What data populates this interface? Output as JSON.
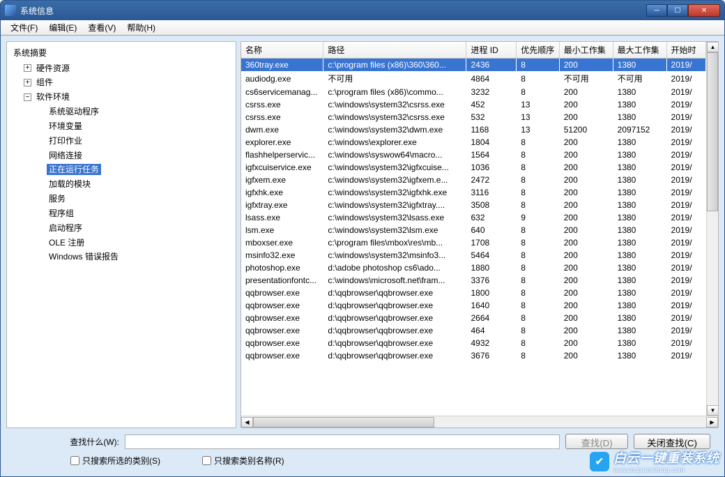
{
  "window": {
    "title": "系统信息"
  },
  "menubar": [
    "文件(F)",
    "编辑(E)",
    "查看(V)",
    "帮助(H)"
  ],
  "tree": {
    "root": "系统摘要",
    "n1": "硬件资源",
    "n2": "组件",
    "n3": "软件环境",
    "n3c": [
      "系统驱动程序",
      "环境变量",
      "打印作业",
      "网络连接",
      "正在运行任务",
      "加载的模块",
      "服务",
      "程序组",
      "启动程序",
      "OLE 注册",
      "Windows 错误报告"
    ]
  },
  "columns": [
    "名称",
    "路径",
    "进程 ID",
    "优先顺序",
    "最小工作集",
    "最大工作集",
    "开始时"
  ],
  "rows": [
    {
      "name": "360tray.exe",
      "path": "c:\\program files (x86)\\360\\360...",
      "pid": "2436",
      "pri": "8",
      "minws": "200",
      "maxws": "1380",
      "t": "2019/",
      "sel": true
    },
    {
      "name": "audiodg.exe",
      "path": "不可用",
      "pid": "4864",
      "pri": "8",
      "minws": "不可用",
      "maxws": "不可用",
      "t": "2019/"
    },
    {
      "name": "cs6servicemanag...",
      "path": "c:\\program files (x86)\\commo...",
      "pid": "3232",
      "pri": "8",
      "minws": "200",
      "maxws": "1380",
      "t": "2019/"
    },
    {
      "name": "csrss.exe",
      "path": "c:\\windows\\system32\\csrss.exe",
      "pid": "452",
      "pri": "13",
      "minws": "200",
      "maxws": "1380",
      "t": "2019/"
    },
    {
      "name": "csrss.exe",
      "path": "c:\\windows\\system32\\csrss.exe",
      "pid": "532",
      "pri": "13",
      "minws": "200",
      "maxws": "1380",
      "t": "2019/"
    },
    {
      "name": "dwm.exe",
      "path": "c:\\windows\\system32\\dwm.exe",
      "pid": "1168",
      "pri": "13",
      "minws": "51200",
      "maxws": "2097152",
      "t": "2019/"
    },
    {
      "name": "explorer.exe",
      "path": "c:\\windows\\explorer.exe",
      "pid": "1804",
      "pri": "8",
      "minws": "200",
      "maxws": "1380",
      "t": "2019/"
    },
    {
      "name": "flashhelperservic...",
      "path": "c:\\windows\\syswow64\\macro...",
      "pid": "1564",
      "pri": "8",
      "minws": "200",
      "maxws": "1380",
      "t": "2019/"
    },
    {
      "name": "igfxcuiservice.exe",
      "path": "c:\\windows\\system32\\igfxcuise...",
      "pid": "1036",
      "pri": "8",
      "minws": "200",
      "maxws": "1380",
      "t": "2019/"
    },
    {
      "name": "igfxem.exe",
      "path": "c:\\windows\\system32\\igfxem.e...",
      "pid": "2472",
      "pri": "8",
      "minws": "200",
      "maxws": "1380",
      "t": "2019/"
    },
    {
      "name": "igfxhk.exe",
      "path": "c:\\windows\\system32\\igfxhk.exe",
      "pid": "3116",
      "pri": "8",
      "minws": "200",
      "maxws": "1380",
      "t": "2019/"
    },
    {
      "name": "igfxtray.exe",
      "path": "c:\\windows\\system32\\igfxtray....",
      "pid": "3508",
      "pri": "8",
      "minws": "200",
      "maxws": "1380",
      "t": "2019/"
    },
    {
      "name": "lsass.exe",
      "path": "c:\\windows\\system32\\lsass.exe",
      "pid": "632",
      "pri": "9",
      "minws": "200",
      "maxws": "1380",
      "t": "2019/"
    },
    {
      "name": "lsm.exe",
      "path": "c:\\windows\\system32\\lsm.exe",
      "pid": "640",
      "pri": "8",
      "minws": "200",
      "maxws": "1380",
      "t": "2019/"
    },
    {
      "name": "mboxser.exe",
      "path": "c:\\program files\\mbox\\res\\mb...",
      "pid": "1708",
      "pri": "8",
      "minws": "200",
      "maxws": "1380",
      "t": "2019/"
    },
    {
      "name": "msinfo32.exe",
      "path": "c:\\windows\\system32\\msinfo3...",
      "pid": "5464",
      "pri": "8",
      "minws": "200",
      "maxws": "1380",
      "t": "2019/"
    },
    {
      "name": "photoshop.exe",
      "path": "d:\\adobe photoshop cs6\\ado...",
      "pid": "1880",
      "pri": "8",
      "minws": "200",
      "maxws": "1380",
      "t": "2019/"
    },
    {
      "name": "presentationfontc...",
      "path": "c:\\windows\\microsoft.net\\fram...",
      "pid": "3376",
      "pri": "8",
      "minws": "200",
      "maxws": "1380",
      "t": "2019/"
    },
    {
      "name": "qqbrowser.exe",
      "path": "d:\\qqbrowser\\qqbrowser.exe",
      "pid": "1800",
      "pri": "8",
      "minws": "200",
      "maxws": "1380",
      "t": "2019/"
    },
    {
      "name": "qqbrowser.exe",
      "path": "d:\\qqbrowser\\qqbrowser.exe",
      "pid": "1640",
      "pri": "8",
      "minws": "200",
      "maxws": "1380",
      "t": "2019/"
    },
    {
      "name": "qqbrowser.exe",
      "path": "d:\\qqbrowser\\qqbrowser.exe",
      "pid": "2664",
      "pri": "8",
      "minws": "200",
      "maxws": "1380",
      "t": "2019/"
    },
    {
      "name": "qqbrowser.exe",
      "path": "d:\\qqbrowser\\qqbrowser.exe",
      "pid": "464",
      "pri": "8",
      "minws": "200",
      "maxws": "1380",
      "t": "2019/"
    },
    {
      "name": "qqbrowser.exe",
      "path": "d:\\qqbrowser\\qqbrowser.exe",
      "pid": "4932",
      "pri": "8",
      "minws": "200",
      "maxws": "1380",
      "t": "2019/"
    },
    {
      "name": "qqbrowser.exe",
      "path": "d:\\qqbrowser\\qqbrowser.exe",
      "pid": "3676",
      "pri": "8",
      "minws": "200",
      "maxws": "1380",
      "t": "2019/"
    }
  ],
  "find": {
    "label": "查找什么(W):",
    "ph": "",
    "find_btn": "查找(D)",
    "close_btn": "关闭查找(C)",
    "cb1": "只搜索所选的类别(S)",
    "cb2": "只搜索类别名称(R)"
  },
  "watermark": {
    "main": "白云一键重装系统",
    "sub": "www.baiyunxitong.com"
  }
}
